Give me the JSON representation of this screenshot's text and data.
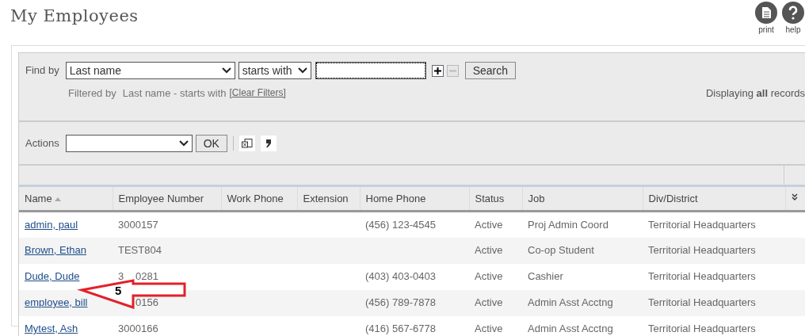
{
  "page": {
    "title": "My Employees"
  },
  "header_tools": [
    {
      "label": "print",
      "kind": "print"
    },
    {
      "label": "help",
      "kind": "help"
    }
  ],
  "find": {
    "label": "Find by",
    "field": "Last name",
    "operator": "starts with",
    "search_button": "Search",
    "filtered_label": "Filtered by",
    "filter_text": "Last name - starts with",
    "clear_link": "[Clear Filters]",
    "display_text": "Displaying **all** records"
  },
  "actions": {
    "label": "Actions",
    "ok_button": "OK"
  },
  "table": {
    "columns": [
      {
        "label": "Name",
        "sorted": true
      },
      {
        "label": "Employee Number",
        "sorted": false
      },
      {
        "label": "Work Phone",
        "sorted": false
      },
      {
        "label": "Extension",
        "sorted": false
      },
      {
        "label": "Home Phone",
        "sorted": false
      },
      {
        "label": "Status",
        "sorted": false
      },
      {
        "label": "Job",
        "sorted": false
      },
      {
        "label": "Div/District",
        "sorted": false
      }
    ],
    "rows": [
      {
        "cells": [
          "admin, paul",
          "3000157",
          "",
          "",
          "(456) 123-4545",
          "Active",
          "Proj Admin Coord",
          "Territorial Headquarters"
        ]
      },
      {
        "cells": [
          "Brown, Ethan",
          "TEST804",
          "",
          "",
          "",
          "Active",
          "Co-op Student",
          "Territorial Headquarters"
        ]
      },
      {
        "cells": [
          "Dude, Dude",
          {
            "parts": [
              "3",
              "0281"
            ]
          },
          "",
          "",
          "(403) 403-0403",
          "Active",
          "Cashier",
          "Territorial Headquarters"
        ]
      },
      {
        "cells": [
          "employee, bill",
          {
            "parts": [
              "0156"
            ]
          },
          "",
          "",
          "(456) 789-7878",
          "Active",
          "Admin Asst Acctng",
          "Territorial Headquarters"
        ]
      },
      {
        "cells": [
          "Mytest, Ash",
          "3000166",
          "",
          "",
          "(416) 567-6778",
          "Active",
          "Admin Asst Acctng",
          "Territorial Headquarters"
        ]
      }
    ]
  },
  "callout": {
    "label": "5"
  }
}
